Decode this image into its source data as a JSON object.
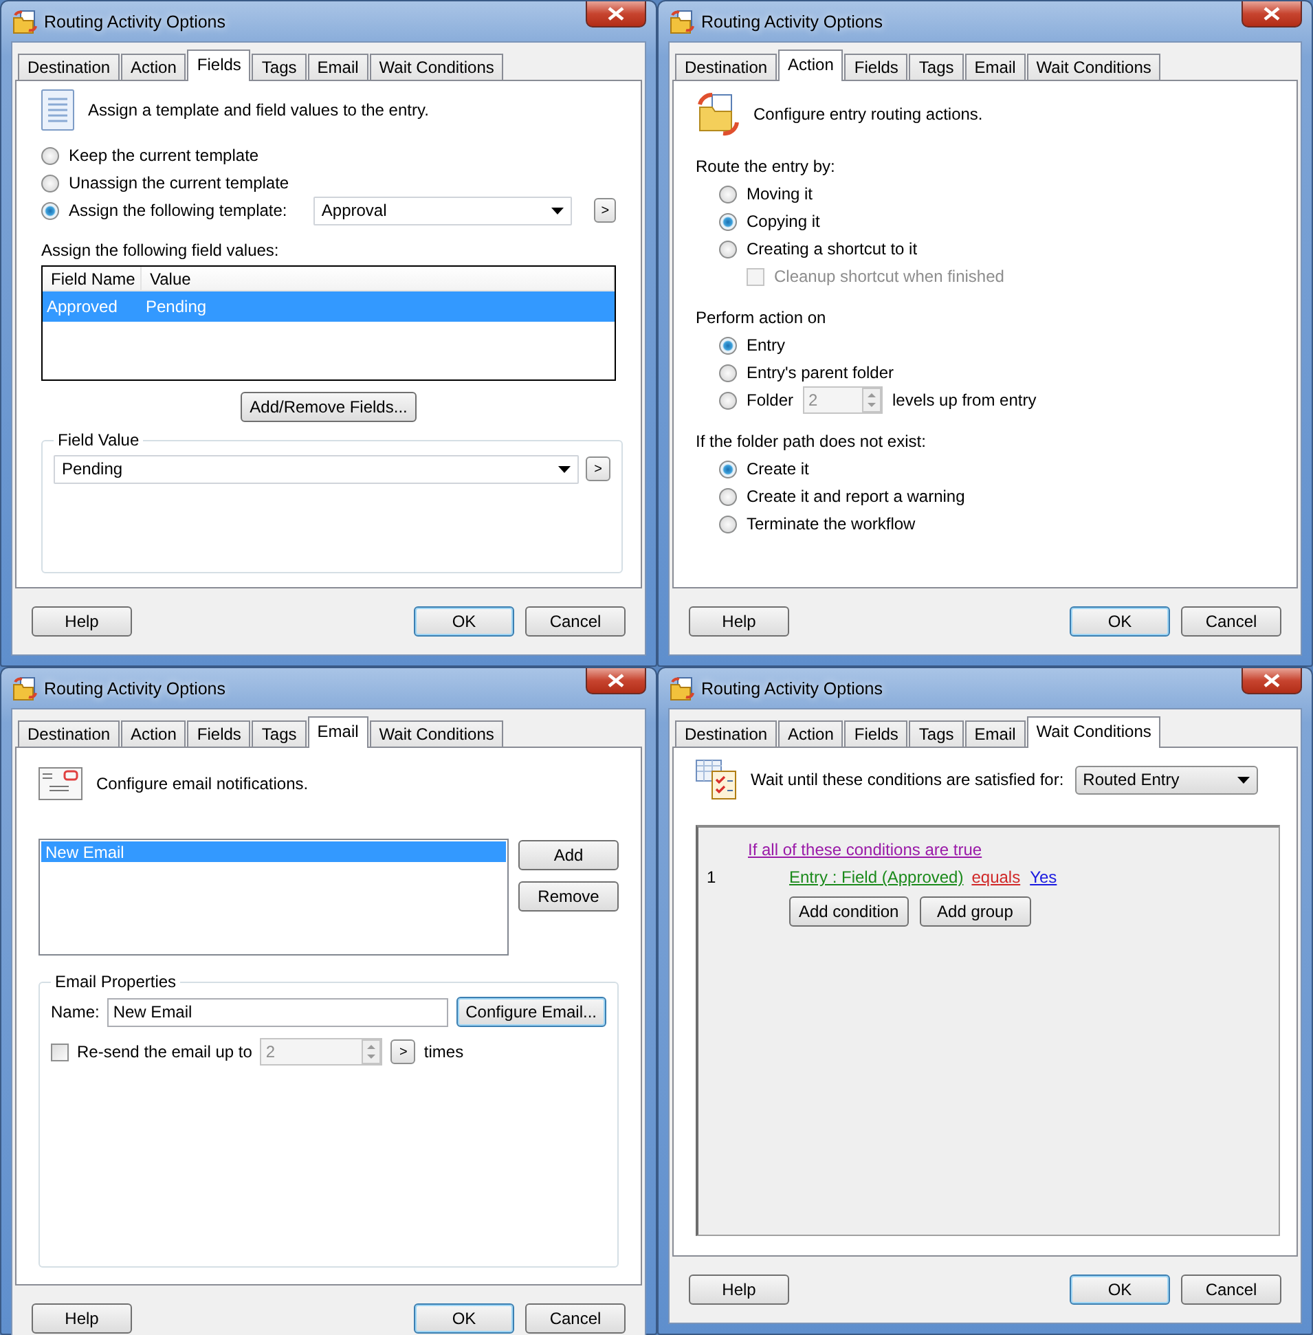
{
  "windows": [
    {
      "kind": "fields",
      "title": "Routing Activity Options",
      "tabs": [
        {
          "label": "Destination",
          "selected": false
        },
        {
          "label": "Action",
          "selected": false
        },
        {
          "label": "Fields",
          "selected": true
        },
        {
          "label": "Tags",
          "selected": false
        },
        {
          "label": "Email",
          "selected": false
        },
        {
          "label": "Wait Conditions",
          "selected": false
        }
      ],
      "header": "Assign a template and field values to the entry.",
      "template_options": [
        {
          "label": "Keep the current template",
          "selected": false
        },
        {
          "label": "Unassign the current template",
          "selected": false
        },
        {
          "label": "Assign the following template:",
          "selected": true
        }
      ],
      "template_select": "Approval",
      "template_browse": ">",
      "values_label": "Assign the following field values:",
      "columns": [
        "Field Name",
        "Value"
      ],
      "rows": [
        {
          "cells": [
            "Approved",
            "Pending"
          ],
          "selected": true
        }
      ],
      "add_remove_button": "Add/Remove Fields...",
      "field_value": {
        "title": "Field Value",
        "value": "Pending",
        "browse": ">"
      },
      "buttons": {
        "help": "Help",
        "ok": "OK",
        "cancel": "Cancel"
      }
    },
    {
      "kind": "action",
      "title": "Routing Activity Options",
      "tabs": [
        {
          "label": "Destination",
          "selected": false
        },
        {
          "label": "Action",
          "selected": true
        },
        {
          "label": "Fields",
          "selected": false
        },
        {
          "label": "Tags",
          "selected": false
        },
        {
          "label": "Email",
          "selected": false
        },
        {
          "label": "Wait Conditions",
          "selected": false
        }
      ],
      "header": "Configure entry routing actions.",
      "groups": [
        {
          "title": "Route the entry by:",
          "options": [
            {
              "kind": "radio",
              "label": "Moving it",
              "selected": false,
              "disabled": false
            },
            {
              "kind": "radio",
              "label": "Copying it",
              "selected": true,
              "disabled": false
            },
            {
              "kind": "radio",
              "label": "Creating a shortcut to it",
              "selected": false,
              "disabled": false
            },
            {
              "kind": "checkbox",
              "label": "Cleanup shortcut when finished",
              "checked": false,
              "disabled": true
            }
          ]
        },
        {
          "title": "Perform action on",
          "options": [
            {
              "kind": "radio",
              "label": "Entry",
              "selected": true,
              "disabled": false
            },
            {
              "kind": "radio",
              "label": "Entry's parent folder",
              "selected": false,
              "disabled": false
            },
            {
              "kind": "spin",
              "label": "Folder",
              "selected": false,
              "disabled": false,
              "spinner": {
                "value": "2",
                "disabled": true
              },
              "suffix": "levels up from entry"
            }
          ]
        },
        {
          "title": "If the folder path does not exist:",
          "options": [
            {
              "kind": "radio",
              "label": "Create it",
              "selected": true,
              "disabled": false
            },
            {
              "kind": "radio",
              "label": "Create it and report a warning",
              "selected": false,
              "disabled": false
            },
            {
              "kind": "radio",
              "label": "Terminate the workflow",
              "selected": false,
              "disabled": false
            }
          ]
        }
      ],
      "buttons": {
        "help": "Help",
        "ok": "OK",
        "cancel": "Cancel"
      }
    },
    {
      "kind": "email",
      "title": "Routing Activity Options",
      "tabs": [
        {
          "label": "Destination",
          "selected": false
        },
        {
          "label": "Action",
          "selected": false
        },
        {
          "label": "Fields",
          "selected": false
        },
        {
          "label": "Tags",
          "selected": false
        },
        {
          "label": "Email",
          "selected": true
        },
        {
          "label": "Wait Conditions",
          "selected": false
        }
      ],
      "header": "Configure email notifications.",
      "emails": [
        {
          "label": "New Email",
          "selected": true
        }
      ],
      "list_buttons": [
        "Add",
        "Remove"
      ],
      "properties": {
        "title": "Email Properties",
        "name_label": "Name:",
        "name_value": "New Email",
        "configure_button": "Configure Email...",
        "resend": {
          "label": "Re-send the email up to",
          "checked": false,
          "spinner": {
            "value": "2",
            "disabled": true
          },
          "browse": ">",
          "suffix": "times"
        }
      },
      "buttons": {
        "help": "Help",
        "ok": "OK",
        "cancel": "Cancel"
      }
    },
    {
      "kind": "wait",
      "title": "Routing Activity Options",
      "tabs": [
        {
          "label": "Destination",
          "selected": false
        },
        {
          "label": "Action",
          "selected": false
        },
        {
          "label": "Fields",
          "selected": false
        },
        {
          "label": "Tags",
          "selected": false
        },
        {
          "label": "Email",
          "selected": false
        },
        {
          "label": "Wait Conditions",
          "selected": true
        }
      ],
      "header": "Wait until these conditions are satisfied for:",
      "target_select": "Routed Entry",
      "group_heading": "If all of these conditions are true",
      "conditions": [
        {
          "number": "1",
          "field": "Entry : Field (Approved)",
          "operator": "equals",
          "value": "Yes"
        }
      ],
      "condition_buttons": [
        "Add condition",
        "Add group"
      ],
      "buttons": {
        "help": "Help",
        "ok": "OK",
        "cancel": "Cancel"
      }
    }
  ]
}
